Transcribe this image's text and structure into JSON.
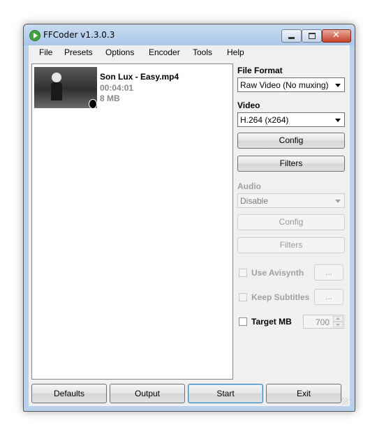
{
  "window": {
    "title": "FFCoder v1.3.0.3"
  },
  "menu": [
    "File",
    "Presets",
    "Options",
    "Encoder",
    "Tools",
    "Help"
  ],
  "file": {
    "name": "Son Lux - Easy.mp4",
    "duration": "00:04:01",
    "size": "8 MB"
  },
  "panel": {
    "file_format": {
      "label": "File Format",
      "value": "Raw Video (No muxing)"
    },
    "video": {
      "label": "Video",
      "codec": "H.264 (x264)",
      "config_label": "Config",
      "filters_label": "Filters"
    },
    "audio": {
      "label": "Audio",
      "value": "Disable",
      "config_label": "Config",
      "filters_label": "Filters"
    },
    "use_avisynth": {
      "label": "Use Avisynth",
      "browse_label": "..."
    },
    "keep_subtitles": {
      "label": "Keep Subtitles",
      "browse_label": "..."
    },
    "target_mb": {
      "label": "Target MB",
      "value": "700"
    }
  },
  "buttons": {
    "defaults": "Defaults",
    "output": "Output",
    "start": "Start",
    "exit": "Exit"
  }
}
